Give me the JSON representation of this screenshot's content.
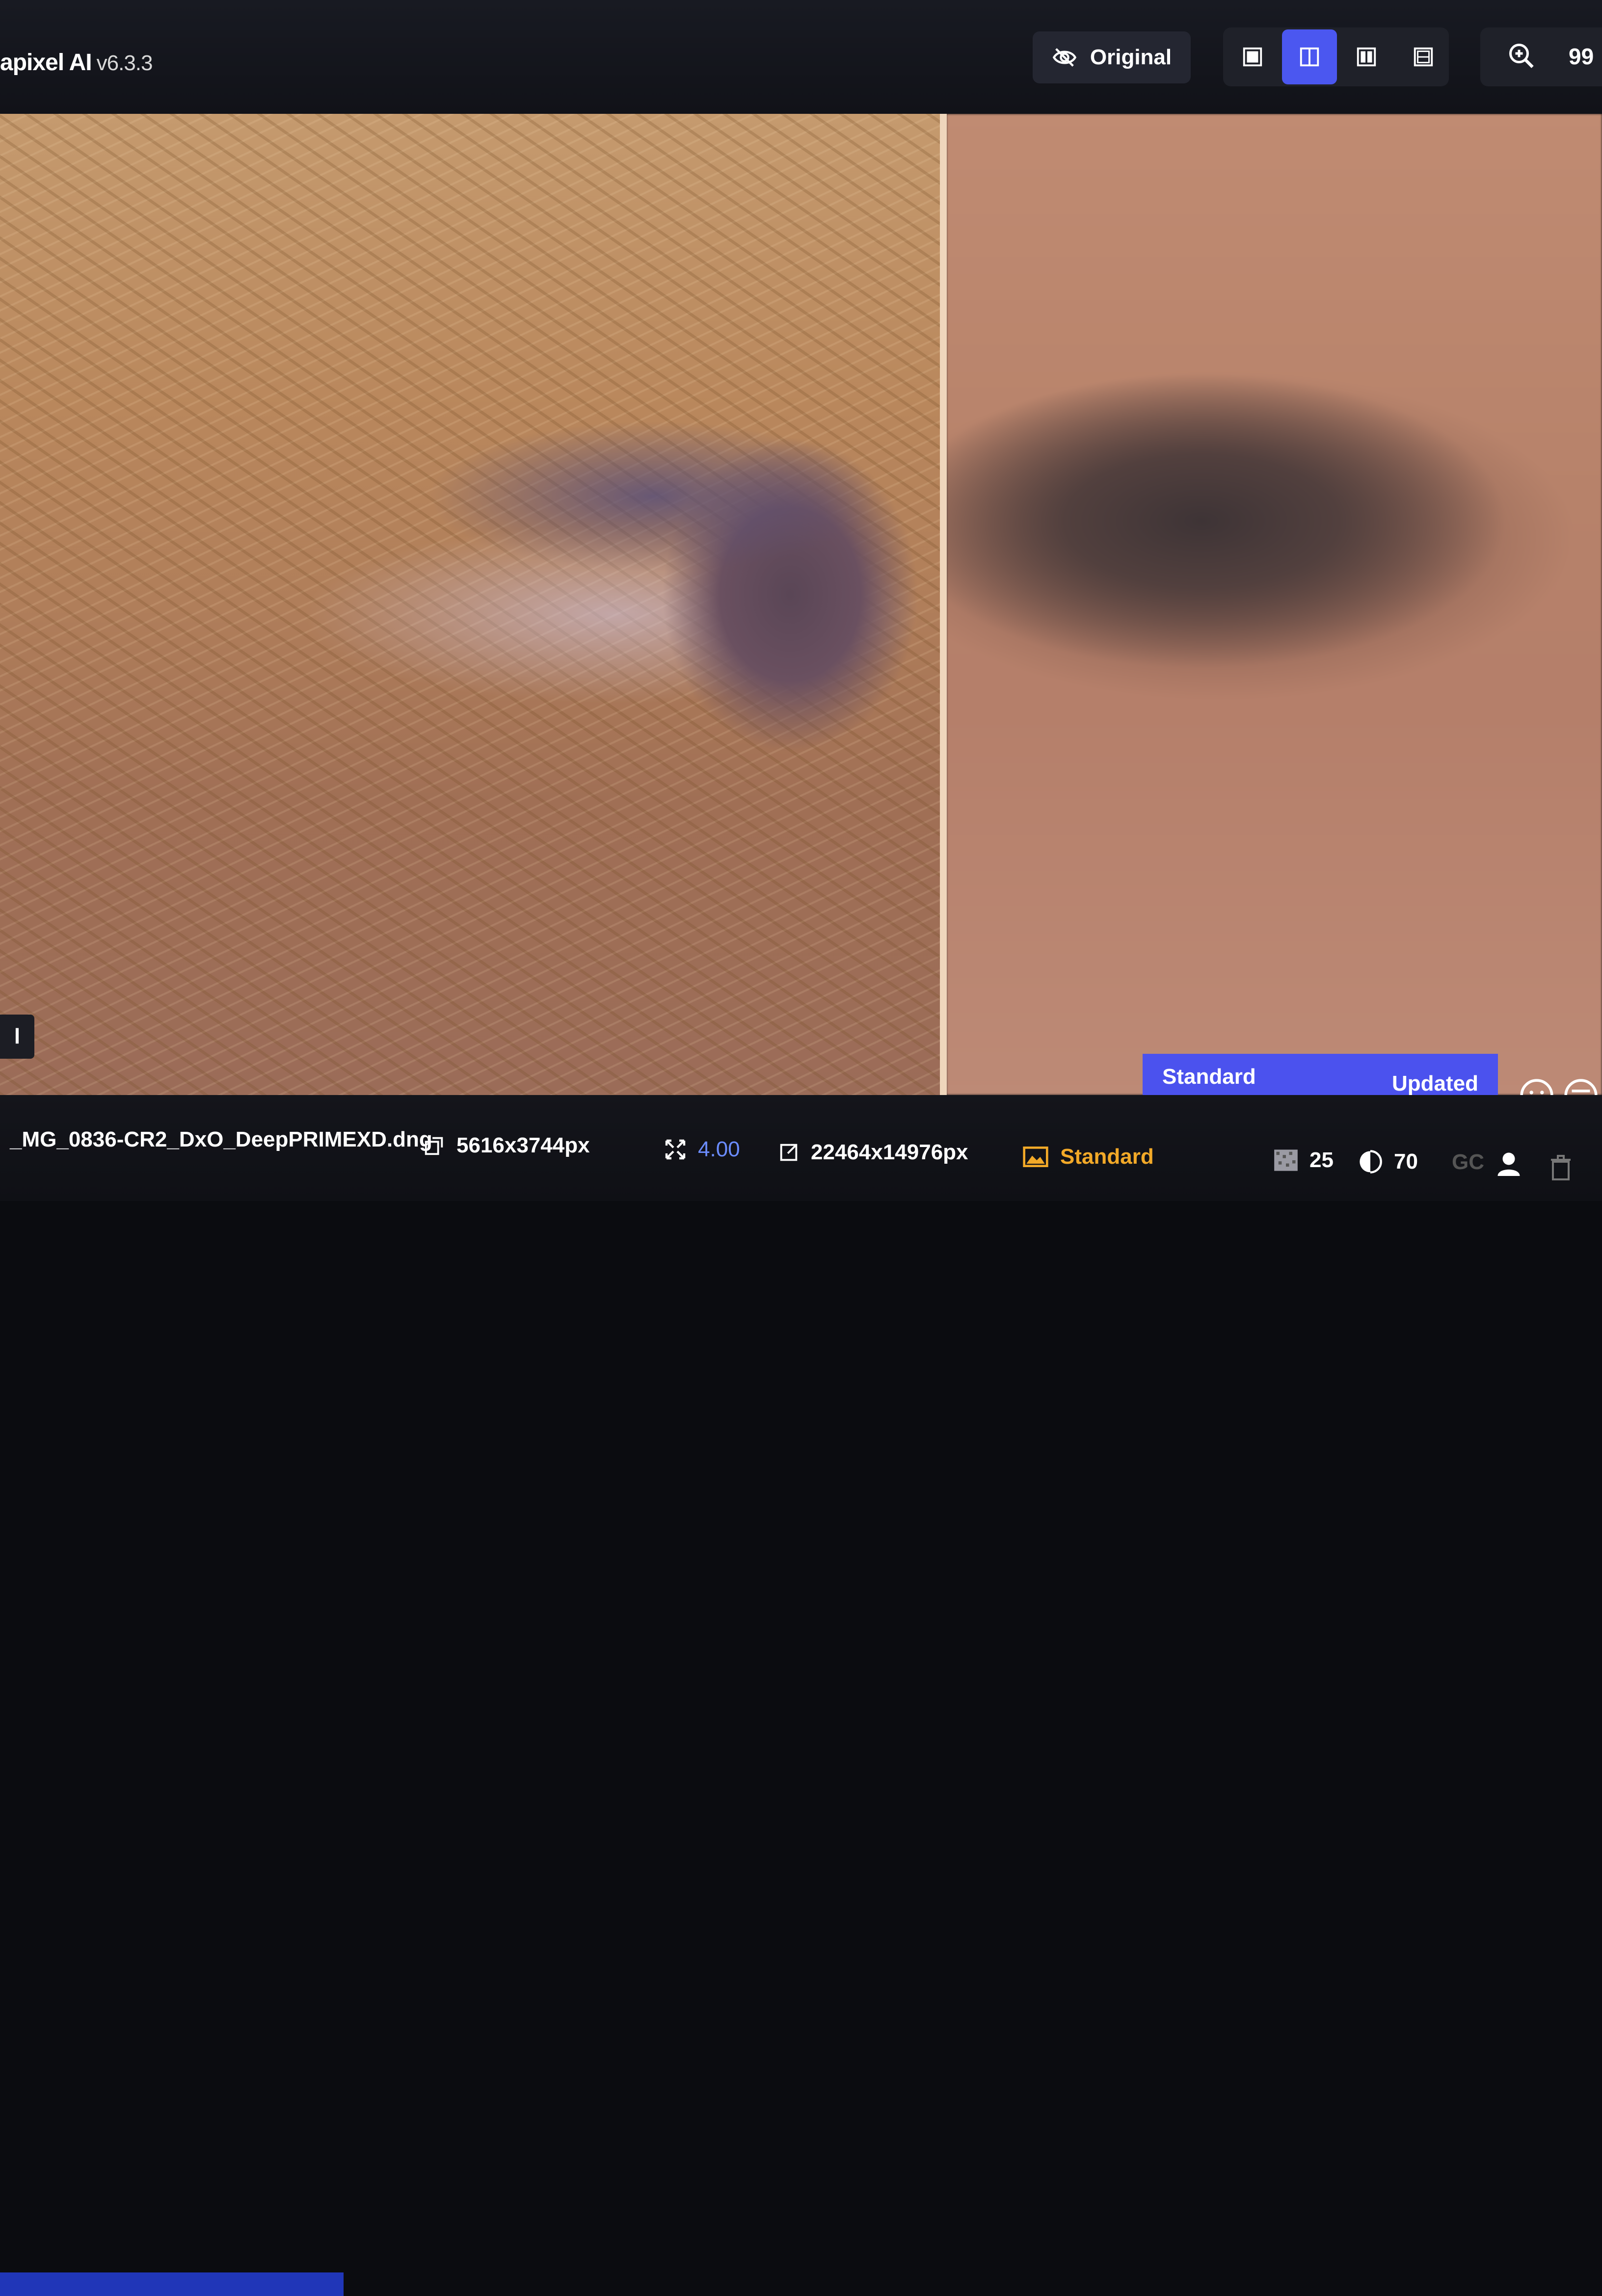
{
  "app": {
    "title": "apixel AI",
    "version": "v6.3.3"
  },
  "toolbar": {
    "original_label": "Original",
    "zoom_value": "99"
  },
  "view_modes": [
    {
      "name": "single",
      "active": false
    },
    {
      "name": "side-by-side",
      "active": true
    },
    {
      "name": "split",
      "active": false
    },
    {
      "name": "grid",
      "active": false
    }
  ],
  "preview": {
    "side_tag": "l",
    "model_left": "Standard",
    "model_right": "Updated"
  },
  "status": {
    "filename": "_MG_0836-CR2_DxO_DeepPRIMEXD.dng",
    "input_size": "5616x3744px",
    "scale": "4.00",
    "output_size": "22464x14976px",
    "model": "Standard",
    "denoise": "25",
    "sharpen": "70",
    "gc": "GC"
  },
  "colors": {
    "accent": "#4b52ee",
    "green": "#3ed36b",
    "orange": "#f2a928",
    "blue_text": "#6b8cff"
  }
}
